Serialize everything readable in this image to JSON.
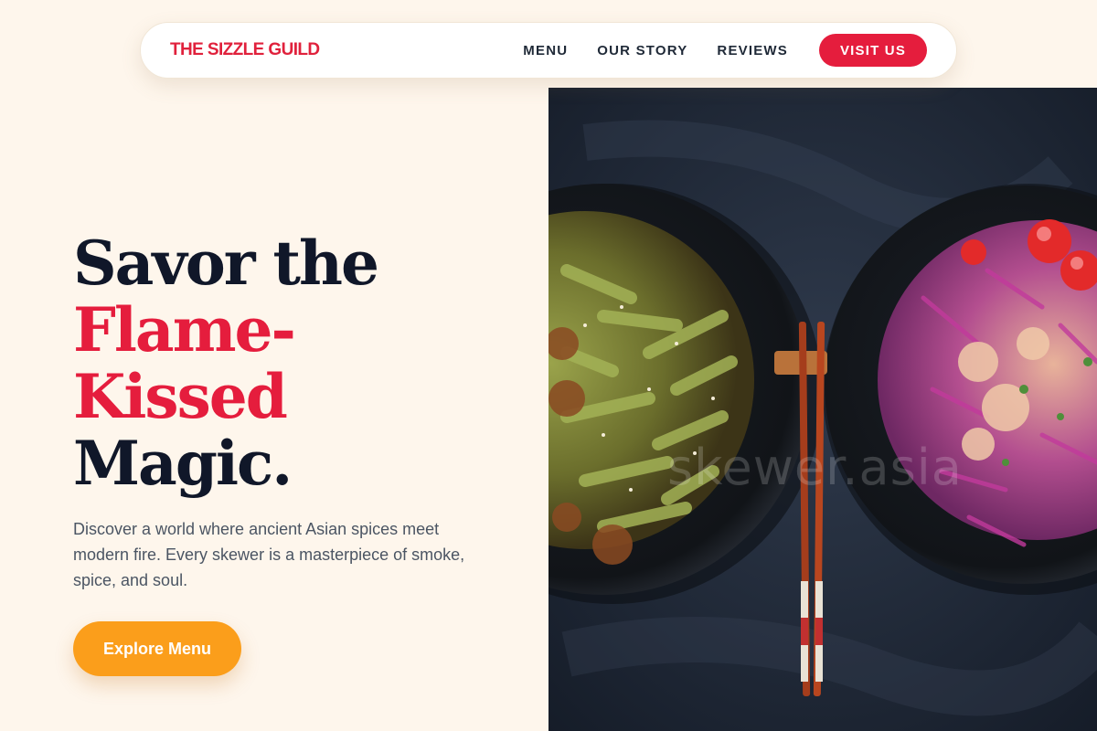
{
  "nav": {
    "brand": "THE SIZZLE GUILD",
    "links": [
      "MENU",
      "OUR STORY",
      "REVIEWS"
    ],
    "cta": "VISIT US"
  },
  "hero": {
    "title_line1": "Savor the",
    "title_accent_line1": "Flame-",
    "title_accent_line2": "Kissed",
    "title_line4": "Magic.",
    "description": "Discover a world where ancient Asian spices meet modern fire. Every skewer is a masterpiece of smoke, spice, and soul.",
    "button": "Explore Menu"
  },
  "image": {
    "watermark": "skewer.asia"
  },
  "colors": {
    "background": "#fef6ec",
    "accent_red": "#e51d3d",
    "accent_orange": "#fb9e1b",
    "heading": "#101729"
  }
}
